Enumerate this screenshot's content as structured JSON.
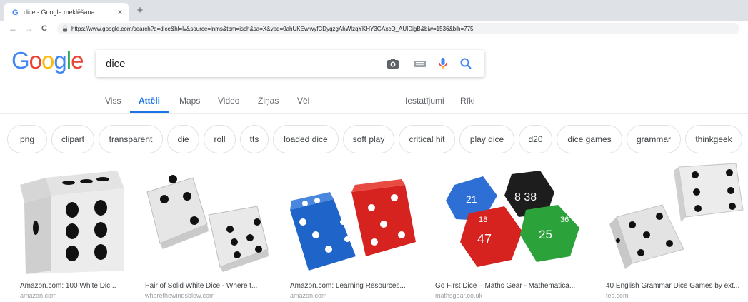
{
  "browser": {
    "tab_title": "dice - Google meklēšana",
    "tab_close": "×",
    "new_tab": "+",
    "back": "←",
    "forward": "→",
    "reload": "C",
    "url": "https://www.google.com/search?q=dice&hl=lv&source=lnms&tbm=isch&sa=X&ved=0ahUKEwiwyfCDyqzgAhWlzqYKHY3GAxcQ_AUIDigB&biw=1536&bih=775"
  },
  "search": {
    "query": "dice",
    "icons": [
      "camera-icon",
      "keyboard-icon",
      "microphone-icon",
      "search-icon"
    ]
  },
  "nav": {
    "tabs": [
      "Viss",
      "Attēli",
      "Maps",
      "Video",
      "Ziņas",
      "Vēl"
    ],
    "active": "Attēli",
    "settings": "Iestatījumi",
    "tools": "Rīki"
  },
  "chips": [
    "png",
    "clipart",
    "transparent",
    "die",
    "roll",
    "tts",
    "loaded dice",
    "soft play",
    "critical hit",
    "play dice",
    "d20",
    "dice games",
    "grammar",
    "thinkgeek"
  ],
  "results": [
    {
      "title": "Amazon.com: 100 White Dic...",
      "source": "amazon.com"
    },
    {
      "title": "Pair of Solid White Dice - Where t...",
      "source": "wherethewindsblow.com"
    },
    {
      "title": "Amazon.com: Learning Resources...",
      "source": "amazon.com"
    },
    {
      "title": "Go First Dice – Maths Gear - Mathematica...",
      "source": "mathsgear.co.uk"
    },
    {
      "title": "40 English Grammar Dice Games by ext...",
      "source": "tes.com"
    }
  ],
  "dice_labels": {
    "blue_d12": "21",
    "black_d12": "8 38",
    "red_d12": "47",
    "red_d12_small": "18",
    "green_d12": "25",
    "green_d12_small": "36"
  },
  "colors": {
    "google_blue": "#4285f4",
    "google_red": "#ea4335",
    "google_yellow": "#fbbc05",
    "google_green": "#34a853",
    "active_tab": "#1a73e8"
  }
}
